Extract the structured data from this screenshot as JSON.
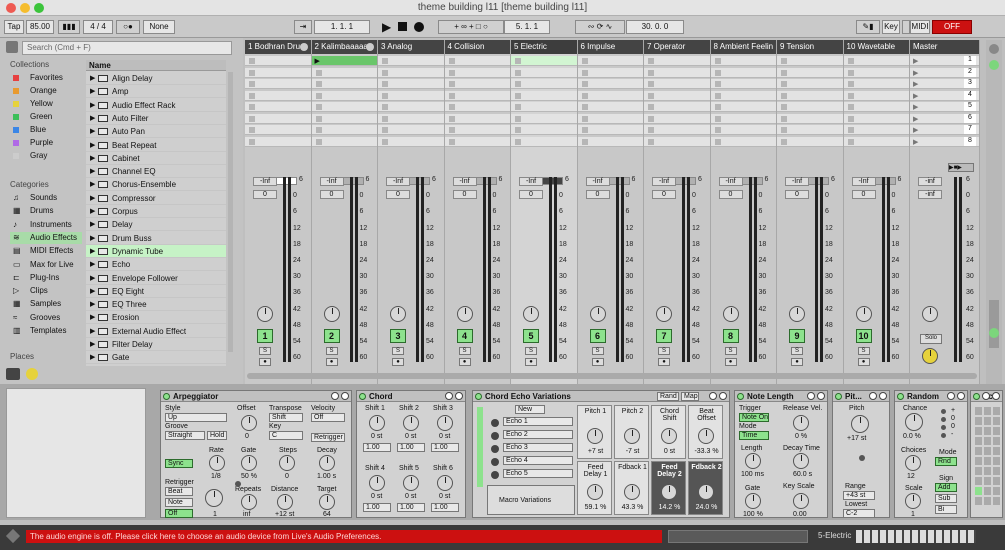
{
  "window": {
    "title": "theme building l11  [theme building l11]"
  },
  "control": {
    "tap": "Tap",
    "tempo": "85.00",
    "sig": "4 / 4",
    "loop": "None",
    "pos": "1.  1.  1",
    "pos2": "5.  1.  1",
    "len": "30.  0.  0",
    "key": "Key",
    "midi": "MIDI",
    "off": "OFF"
  },
  "browser": {
    "search": "Search (Cmd + F)",
    "collections_label": "Collections",
    "categories_label": "Categories",
    "places_label": "Places",
    "collections": [
      "Favorites",
      "Orange",
      "Yellow",
      "Green",
      "Blue",
      "Purple",
      "Gray"
    ],
    "collection_colors": [
      "#e64040",
      "#e89a30",
      "#e6d23c",
      "#3cbf5a",
      "#3a86e6",
      "#b06ae6",
      "#cccccc"
    ],
    "categories": [
      "Sounds",
      "Drums",
      "Instruments",
      "Audio Effects",
      "MIDI Effects",
      "Max for Live",
      "Plug-Ins",
      "Clips",
      "Samples",
      "Grooves",
      "Templates"
    ],
    "name_header": "Name",
    "files": [
      "Align Delay",
      "Amp",
      "Audio Effect Rack",
      "Auto Filter",
      "Auto Pan",
      "Beat Repeat",
      "Cabinet",
      "Channel EQ",
      "Chorus-Ensemble",
      "Compressor",
      "Corpus",
      "Delay",
      "Drum Buss",
      "Dynamic Tube",
      "Echo",
      "Envelope Follower",
      "EQ Eight",
      "EQ Three",
      "Erosion",
      "External Audio Effect",
      "Filter Delay",
      "Gate"
    ]
  },
  "tracks": [
    {
      "name": "1 Bodhran Dru",
      "num": "1"
    },
    {
      "name": "2 Kalimbaaaaa",
      "num": "2"
    },
    {
      "name": "3 Analog",
      "num": "3"
    },
    {
      "name": "4 Collision",
      "num": "4"
    },
    {
      "name": "5 Electric",
      "num": "5"
    },
    {
      "name": "6 Impulse",
      "num": "6"
    },
    {
      "name": "7 Operator",
      "num": "7"
    },
    {
      "name": "8 Ambient Feelin",
      "num": "8"
    },
    {
      "name": "9 Tension",
      "num": "9"
    },
    {
      "name": "10 Wavetable",
      "num": "10"
    }
  ],
  "master": {
    "name": "Master",
    "scenes": [
      "1",
      "2",
      "3",
      "4",
      "5",
      "6",
      "7",
      "8"
    ],
    "solo": "Solo",
    "inf": "-inf"
  },
  "mixer": {
    "inf": "-Inf",
    "zero": "0",
    "s": "S",
    "ticks": [
      "6",
      "0",
      "6",
      "12",
      "18",
      "24",
      "30",
      "36",
      "42",
      "48",
      "54",
      "60"
    ]
  },
  "devices": {
    "arp": {
      "title": "Arpeggiator",
      "style": "Style",
      "style_v": "Up",
      "groove": "Groove",
      "groove_v": "Straight",
      "hold": "Hold",
      "offset": "Offset",
      "offset_v": "0",
      "transpose": "Transpose",
      "transpose_v": "Shift",
      "key": "Key",
      "key_v": "C",
      "velocity": "Velocity",
      "vel_v": "Off",
      "retrigger_btn": "Retrigger",
      "sync": "Sync",
      "rate": "Rate",
      "rate_v": "1/8",
      "gate": "Gate",
      "gate_v": "50 %",
      "steps": "Steps",
      "steps_v": "0",
      "decay": "Decay",
      "decay_v": "1.00 s",
      "retrigger": "Retrigger",
      "beat": "Beat",
      "note": "Note",
      "off": "Off",
      "repeats": "Repeats",
      "repeats_v": "inf",
      "one": "1",
      "distance": "Distance",
      "distance_v": "+12 st",
      "target": "Target",
      "target_v": "64"
    },
    "chord": {
      "title": "Chord",
      "shifts": [
        "Shift 1",
        "Shift 2",
        "Shift 3",
        "Shift 4",
        "Shift 5",
        "Shift 6"
      ],
      "st": "0 st",
      "vel": "1.00"
    },
    "cev": {
      "title": "Chord Echo Variations",
      "rand": "Rand",
      "map": "Map",
      "new": "New",
      "echoes": [
        "Echo 1",
        "Echo 2",
        "Echo 3",
        "Echo 4",
        "Echo 5"
      ],
      "macro": "Macro Variations",
      "macros": [
        {
          "l": "Pitch 1",
          "v": "+7 st"
        },
        {
          "l": "Pitch 2",
          "v": "-7 st"
        },
        {
          "l": "Chord Shift",
          "v": "0 st"
        },
        {
          "l": "Beat Offset",
          "v": "-33.3 %"
        },
        {
          "l": "Feed Delay 1",
          "v": "59.1 %"
        },
        {
          "l": "Fdback 1",
          "v": "43.3 %"
        },
        {
          "l": "Feed Delay 2",
          "v": "14.2 %"
        },
        {
          "l": "Fdback 2",
          "v": "24.0 %"
        }
      ]
    },
    "nl": {
      "title": "Note Length",
      "trigger": "Trigger",
      "trigger_v": "Note On",
      "mode": "Mode",
      "mode_v": "Time",
      "release": "Release Vel.",
      "release_v": "0 %",
      "length": "Length",
      "length_v": "100 ms",
      "decay": "Decay Time",
      "decay_v": "60.0 s",
      "gate": "Gate",
      "gate_v": "100 %",
      "keyscale": "Key Scale",
      "keyscale_v": "0.00"
    },
    "pitch": {
      "title": "Pit...",
      "pitch": "Pitch",
      "pitch_v": "+17 st",
      "range": "Range",
      "range_v": "+43 st",
      "lowest": "Lowest",
      "lowest_v": "C-2"
    },
    "random": {
      "title": "Random",
      "chance": "Chance",
      "chance_v": "0.0 %",
      "choices": "Choices",
      "choices_v": "12",
      "scale": "Scale",
      "scale_v": "1",
      "mode": "Mode",
      "mode_v": "Rnd",
      "sign": "Sign",
      "add": "Add",
      "sub": "Sub",
      "bi": "Bi",
      "pm": [
        "+",
        "0",
        "0",
        "-"
      ]
    },
    "scale": {
      "title": "Scal"
    }
  },
  "status": {
    "error": "The audio engine is off. Please click here to choose an audio device from Live's Audio Preferences.",
    "track": "5-Electric"
  }
}
